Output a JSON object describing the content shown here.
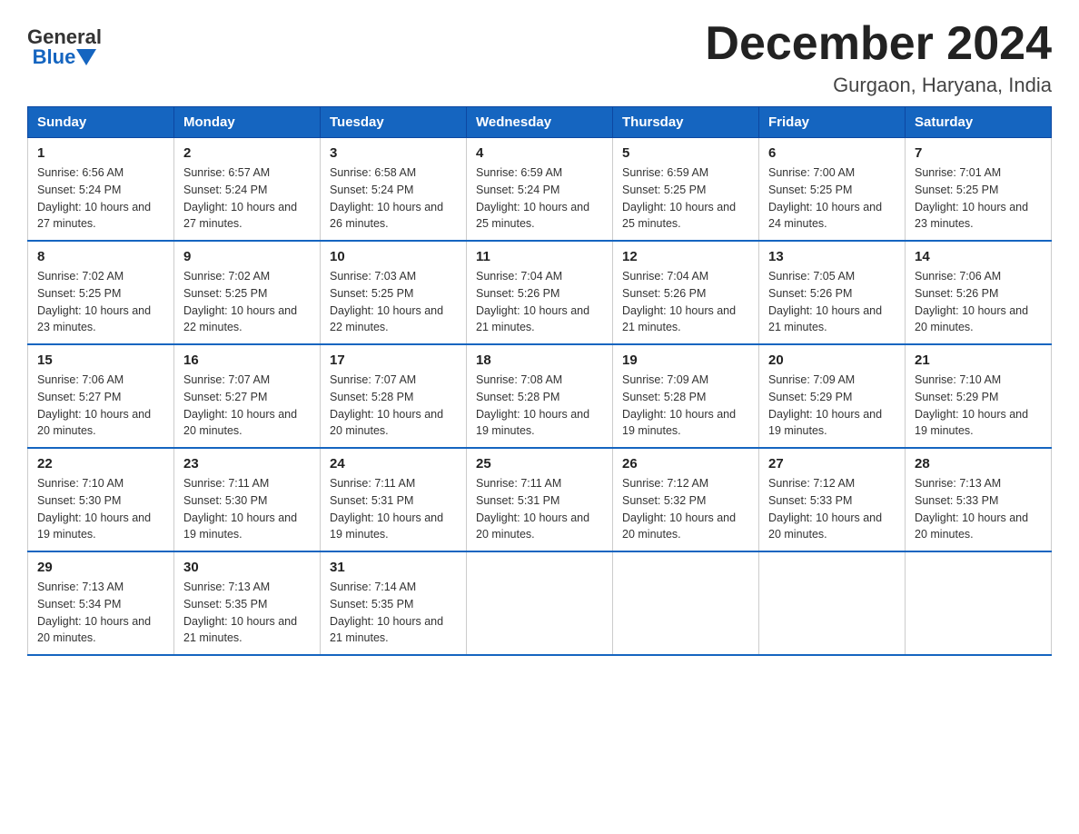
{
  "logo": {
    "text_top": "General",
    "text_bottom": "Blue"
  },
  "title": "December 2024",
  "subtitle": "Gurgaon, Haryana, India",
  "days_of_week": [
    "Sunday",
    "Monday",
    "Tuesday",
    "Wednesday",
    "Thursday",
    "Friday",
    "Saturday"
  ],
  "weeks": [
    [
      {
        "day": 1,
        "sunrise": "6:56 AM",
        "sunset": "5:24 PM",
        "daylight": "10 hours and 27 minutes."
      },
      {
        "day": 2,
        "sunrise": "6:57 AM",
        "sunset": "5:24 PM",
        "daylight": "10 hours and 27 minutes."
      },
      {
        "day": 3,
        "sunrise": "6:58 AM",
        "sunset": "5:24 PM",
        "daylight": "10 hours and 26 minutes."
      },
      {
        "day": 4,
        "sunrise": "6:59 AM",
        "sunset": "5:24 PM",
        "daylight": "10 hours and 25 minutes."
      },
      {
        "day": 5,
        "sunrise": "6:59 AM",
        "sunset": "5:25 PM",
        "daylight": "10 hours and 25 minutes."
      },
      {
        "day": 6,
        "sunrise": "7:00 AM",
        "sunset": "5:25 PM",
        "daylight": "10 hours and 24 minutes."
      },
      {
        "day": 7,
        "sunrise": "7:01 AM",
        "sunset": "5:25 PM",
        "daylight": "10 hours and 23 minutes."
      }
    ],
    [
      {
        "day": 8,
        "sunrise": "7:02 AM",
        "sunset": "5:25 PM",
        "daylight": "10 hours and 23 minutes."
      },
      {
        "day": 9,
        "sunrise": "7:02 AM",
        "sunset": "5:25 PM",
        "daylight": "10 hours and 22 minutes."
      },
      {
        "day": 10,
        "sunrise": "7:03 AM",
        "sunset": "5:25 PM",
        "daylight": "10 hours and 22 minutes."
      },
      {
        "day": 11,
        "sunrise": "7:04 AM",
        "sunset": "5:26 PM",
        "daylight": "10 hours and 21 minutes."
      },
      {
        "day": 12,
        "sunrise": "7:04 AM",
        "sunset": "5:26 PM",
        "daylight": "10 hours and 21 minutes."
      },
      {
        "day": 13,
        "sunrise": "7:05 AM",
        "sunset": "5:26 PM",
        "daylight": "10 hours and 21 minutes."
      },
      {
        "day": 14,
        "sunrise": "7:06 AM",
        "sunset": "5:26 PM",
        "daylight": "10 hours and 20 minutes."
      }
    ],
    [
      {
        "day": 15,
        "sunrise": "7:06 AM",
        "sunset": "5:27 PM",
        "daylight": "10 hours and 20 minutes."
      },
      {
        "day": 16,
        "sunrise": "7:07 AM",
        "sunset": "5:27 PM",
        "daylight": "10 hours and 20 minutes."
      },
      {
        "day": 17,
        "sunrise": "7:07 AM",
        "sunset": "5:28 PM",
        "daylight": "10 hours and 20 minutes."
      },
      {
        "day": 18,
        "sunrise": "7:08 AM",
        "sunset": "5:28 PM",
        "daylight": "10 hours and 19 minutes."
      },
      {
        "day": 19,
        "sunrise": "7:09 AM",
        "sunset": "5:28 PM",
        "daylight": "10 hours and 19 minutes."
      },
      {
        "day": 20,
        "sunrise": "7:09 AM",
        "sunset": "5:29 PM",
        "daylight": "10 hours and 19 minutes."
      },
      {
        "day": 21,
        "sunrise": "7:10 AM",
        "sunset": "5:29 PM",
        "daylight": "10 hours and 19 minutes."
      }
    ],
    [
      {
        "day": 22,
        "sunrise": "7:10 AM",
        "sunset": "5:30 PM",
        "daylight": "10 hours and 19 minutes."
      },
      {
        "day": 23,
        "sunrise": "7:11 AM",
        "sunset": "5:30 PM",
        "daylight": "10 hours and 19 minutes."
      },
      {
        "day": 24,
        "sunrise": "7:11 AM",
        "sunset": "5:31 PM",
        "daylight": "10 hours and 19 minutes."
      },
      {
        "day": 25,
        "sunrise": "7:11 AM",
        "sunset": "5:31 PM",
        "daylight": "10 hours and 20 minutes."
      },
      {
        "day": 26,
        "sunrise": "7:12 AM",
        "sunset": "5:32 PM",
        "daylight": "10 hours and 20 minutes."
      },
      {
        "day": 27,
        "sunrise": "7:12 AM",
        "sunset": "5:33 PM",
        "daylight": "10 hours and 20 minutes."
      },
      {
        "day": 28,
        "sunrise": "7:13 AM",
        "sunset": "5:33 PM",
        "daylight": "10 hours and 20 minutes."
      }
    ],
    [
      {
        "day": 29,
        "sunrise": "7:13 AM",
        "sunset": "5:34 PM",
        "daylight": "10 hours and 20 minutes."
      },
      {
        "day": 30,
        "sunrise": "7:13 AM",
        "sunset": "5:35 PM",
        "daylight": "10 hours and 21 minutes."
      },
      {
        "day": 31,
        "sunrise": "7:14 AM",
        "sunset": "5:35 PM",
        "daylight": "10 hours and 21 minutes."
      },
      null,
      null,
      null,
      null
    ]
  ],
  "labels": {
    "sunrise_prefix": "Sunrise: ",
    "sunset_prefix": "Sunset: ",
    "daylight_prefix": "Daylight: "
  }
}
